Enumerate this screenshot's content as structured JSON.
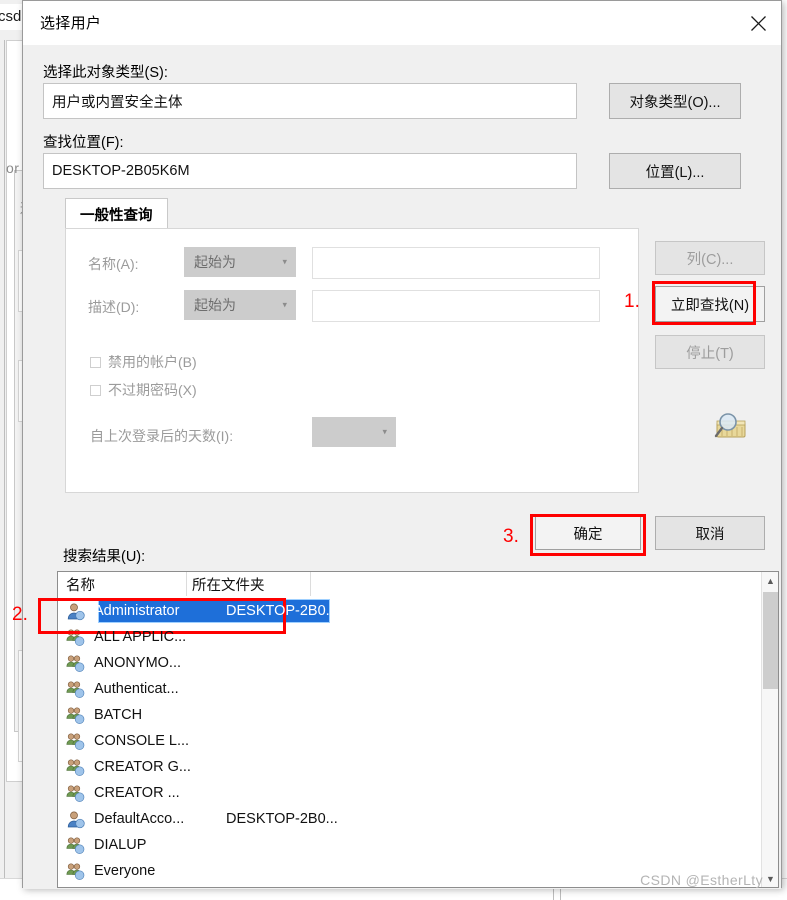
{
  "background": {
    "watermark_topleft": "csdn",
    "label_or": "or",
    "label_song": "送"
  },
  "dialog": {
    "title": "选择用户",
    "close_icon": "close-icon",
    "object_type": {
      "label": "选择此对象类型(S):",
      "value": "用户或内置安全主体",
      "button": "对象类型(O)..."
    },
    "location": {
      "label": "查找位置(F):",
      "value": "DESKTOP-2B05K6M",
      "button": "位置(L)..."
    },
    "tab": {
      "label": "一般性查询"
    },
    "query": {
      "name_label": "名称(A):",
      "name_condition": "起始为",
      "name_value": "",
      "desc_label": "描述(D):",
      "desc_condition": "起始为",
      "desc_value": "",
      "disabled_accounts": "禁用的帐户(B)",
      "non_expiring_password": "不过期密码(X)",
      "days_since_logon_label": "自上次登录后的天数(I):",
      "days_since_logon_value": ""
    },
    "side_buttons": {
      "columns": "列(C)...",
      "find_now": "立即查找(N)",
      "stop": "停止(T)",
      "find_icon": "magnifier-find-icon"
    },
    "action_buttons": {
      "ok": "确定",
      "cancel": "取消"
    },
    "results": {
      "label": "搜索结果(U):",
      "columns": [
        "名称",
        "所在文件夹"
      ],
      "rows": [
        {
          "name": "Administrator",
          "folder": "DESKTOP-2B0...",
          "icon": "user-icon",
          "selected": true
        },
        {
          "name": "ALL APPLIC...",
          "folder": "",
          "icon": "group-icon",
          "selected": false
        },
        {
          "name": "ANONYMO...",
          "folder": "",
          "icon": "group-icon",
          "selected": false
        },
        {
          "name": "Authenticat...",
          "folder": "",
          "icon": "group-icon",
          "selected": false
        },
        {
          "name": "BATCH",
          "folder": "",
          "icon": "group-icon",
          "selected": false
        },
        {
          "name": "CONSOLE L...",
          "folder": "",
          "icon": "group-icon",
          "selected": false
        },
        {
          "name": "CREATOR G...",
          "folder": "",
          "icon": "group-icon",
          "selected": false
        },
        {
          "name": "CREATOR ...",
          "folder": "",
          "icon": "group-icon",
          "selected": false
        },
        {
          "name": "DefaultAcco...",
          "folder": "DESKTOP-2B0...",
          "icon": "user-icon",
          "selected": false
        },
        {
          "name": "DIALUP",
          "folder": "",
          "icon": "group-icon",
          "selected": false
        },
        {
          "name": "Everyone",
          "folder": "",
          "icon": "group-icon",
          "selected": false
        }
      ],
      "scroll_up_icon": "chevron-up-icon",
      "scroll_down_icon": "chevron-down-icon"
    }
  },
  "annotations": {
    "step1": "1.",
    "step2": "2.",
    "step3": "3.",
    "color": "#fe0000"
  },
  "watermark": "CSDN @EstherLty"
}
